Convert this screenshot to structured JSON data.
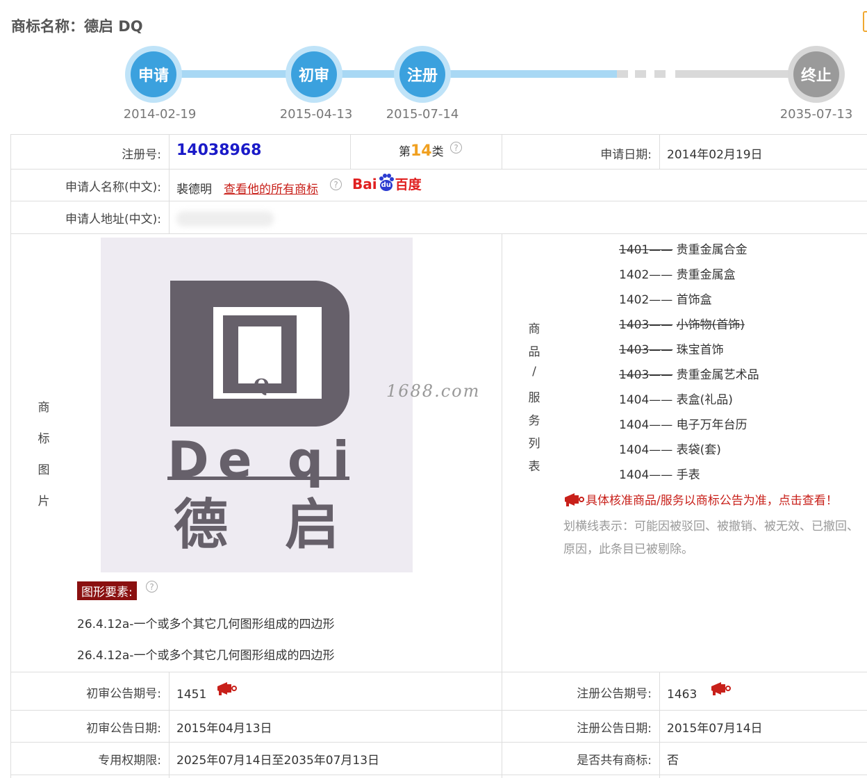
{
  "title": "商标名称：德启 DQ",
  "timeline": [
    {
      "label": "申请",
      "date": "2014-02-19",
      "state": "active"
    },
    {
      "label": "初审",
      "date": "2015-04-13",
      "state": "active"
    },
    {
      "label": "注册",
      "date": "2015-07-14",
      "state": "active"
    },
    {
      "label": "终止",
      "date": "2035-07-13",
      "state": "inactive"
    }
  ],
  "row1": {
    "reg_label": "注册号:",
    "reg_value": "14038968",
    "class_prefix": "第",
    "class_num": "14",
    "class_suffix": "类",
    "help": "?",
    "apply_date_label": "申请日期:",
    "apply_date_value": "2014年02月19日"
  },
  "row2": {
    "label": "申请人名称(中文):",
    "name": "裴德明",
    "link": "查看他的所有商标",
    "help": "?",
    "baidu_text": "Bai",
    "baidu_cn": "百度",
    "baidu_paw": "du"
  },
  "row3": {
    "label": "申请人地址(中文):"
  },
  "image_section": {
    "side_label": [
      "商",
      "标",
      "图",
      "片"
    ],
    "watermark": "1688.com",
    "logo_text_latin": "De qi",
    "logo_text_cn_1": "德",
    "logo_text_cn_2": "启",
    "logo_q": "Q",
    "elements_title": "图形要素:",
    "help": "?",
    "elements": [
      "26.4.12a-一个或多个其它几何图形组成的四边形",
      "26.4.12a-一个或多个其它几何图形组成的四边形"
    ]
  },
  "goods_section": {
    "side_label": [
      "商",
      "品",
      "/",
      "服",
      "务",
      "列",
      "表"
    ],
    "items": [
      {
        "code": "1401",
        "dash": "——",
        "name": "贵重金属合金",
        "struck_code": true,
        "struck_name": false
      },
      {
        "code": "1402",
        "dash": "——",
        "name": "贵重金属盒",
        "struck_code": false,
        "struck_name": false
      },
      {
        "code": "1402",
        "dash": "——",
        "name": "首饰盒",
        "struck_code": false,
        "struck_name": false
      },
      {
        "code": "1403",
        "dash": "——",
        "name": "小饰物(首饰)",
        "struck_code": true,
        "struck_name": true
      },
      {
        "code": "1403",
        "dash": "——",
        "name": "珠宝首饰",
        "struck_code": true,
        "struck_name": false
      },
      {
        "code": "1403",
        "dash": "——",
        "name": "贵重金属艺术品",
        "struck_code": true,
        "struck_name": false
      },
      {
        "code": "1404",
        "dash": "——",
        "name": "表盒(礼品)",
        "struck_code": false,
        "struck_name": false
      },
      {
        "code": "1404",
        "dash": "——",
        "name": "电子万年台历",
        "struck_code": false,
        "struck_name": false
      },
      {
        "code": "1404",
        "dash": "——",
        "name": "表袋(套)",
        "struck_code": false,
        "struck_name": false
      },
      {
        "code": "1404",
        "dash": "——",
        "name": "手表",
        "struck_code": false,
        "struck_name": false
      }
    ],
    "notice": "具体核准商品/服务以商标公告为准，点击查看！",
    "note_line1": "划横线表示：可能因被驳回、被撤销、被无效、已撤回、",
    "note_line2": "原因，此条目已被剔除。"
  },
  "bottom": {
    "prelim_pub_no_label": "初审公告期号:",
    "prelim_pub_no": "1451",
    "reg_pub_no_label": "注册公告期号:",
    "reg_pub_no": "1463",
    "prelim_pub_date_label": "初审公告日期:",
    "prelim_pub_date": "2015年04月13日",
    "reg_pub_date_label": "注册公告日期:",
    "reg_pub_date": "2015年07月14日",
    "term_label": "专用权期限:",
    "term_value": "2025年07月14日至2035年07月13日",
    "shared_label": "是否共有商标:",
    "shared_value": "否"
  },
  "colors": {
    "accent_blue": "#3ba1de",
    "link_red": "#c8201a",
    "class_orange": "#f0a020",
    "reg_blue": "#1a1ac8"
  }
}
